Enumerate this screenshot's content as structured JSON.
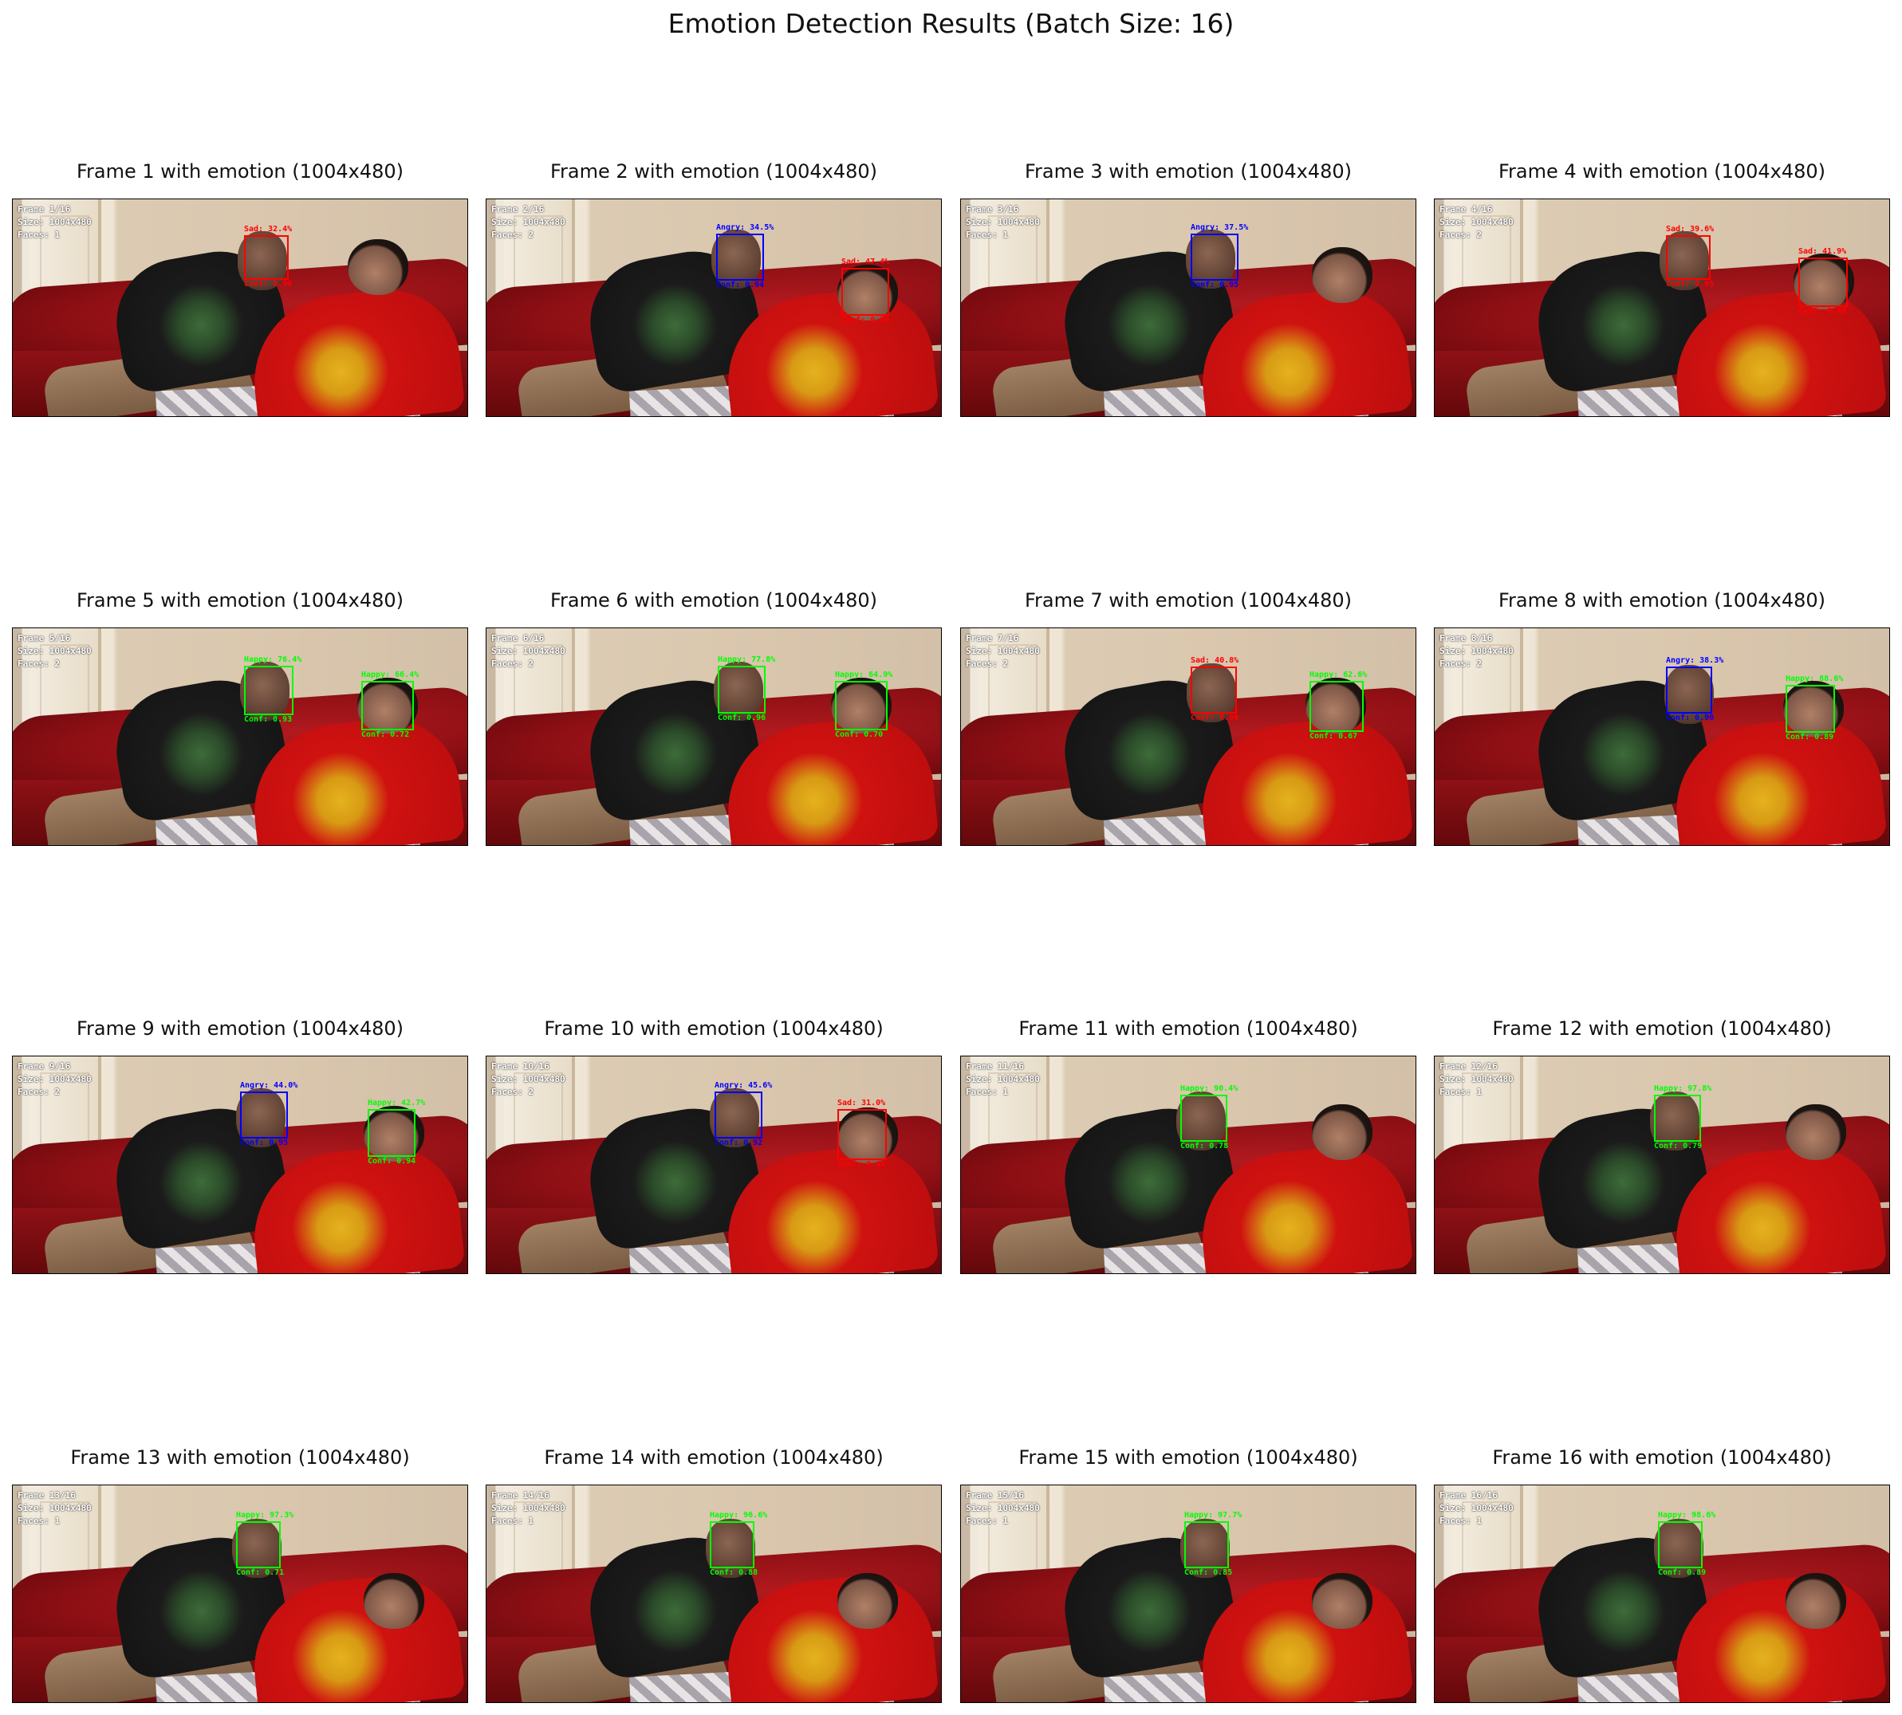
{
  "figure": {
    "title": "Emotion Detection Results (Batch Size: 16)"
  },
  "colors": {
    "happy": "#00ff00",
    "sad": "#ff0000",
    "angry": "#0000ff",
    "overlay_text": "#ffffff"
  },
  "panels": [
    {
      "title": "Frame 1 with emotion (1004x480)",
      "overlay": [
        "Frame 1/16",
        "Size: 1004x480",
        "Faces: 1"
      ],
      "faces": [
        {
          "emotion_label": "Sad: 32.4%",
          "conf_label": "Conf: 0.90",
          "emotion": "sad"
        }
      ]
    },
    {
      "title": "Frame 2 with emotion (1004x480)",
      "overlay": [
        "Frame 2/16",
        "Size: 1004x480",
        "Faces: 2"
      ],
      "faces": [
        {
          "emotion_label": "Angry: 34.5%",
          "conf_label": "Conf: 0.94",
          "emotion": "angry"
        },
        {
          "emotion_label": "Sad: 47.4%",
          "conf_label": "Conf: 0.80",
          "emotion": "sad"
        }
      ]
    },
    {
      "title": "Frame 3 with emotion (1004x480)",
      "overlay": [
        "Frame 3/16",
        "Size: 1004x480",
        "Faces: 1"
      ],
      "faces": [
        {
          "emotion_label": "Angry: 37.5%",
          "conf_label": "Conf: 0.95",
          "emotion": "angry"
        }
      ]
    },
    {
      "title": "Frame 4 with emotion (1004x480)",
      "overlay": [
        "Frame 4/16",
        "Size: 1004x480",
        "Faces: 2"
      ],
      "faces": [
        {
          "emotion_label": "Sad: 39.6%",
          "conf_label": "Conf: 0.95",
          "emotion": "sad"
        },
        {
          "emotion_label": "Sad: 41.9%",
          "conf_label": "Conf: 0.46",
          "emotion": "sad"
        }
      ]
    },
    {
      "title": "Frame 5 with emotion (1004x480)",
      "overlay": [
        "Frame 5/16",
        "Size: 1004x480",
        "Faces: 2"
      ],
      "faces": [
        {
          "emotion_label": "Happy: 76.4%",
          "conf_label": "Conf: 0.93",
          "emotion": "happy"
        },
        {
          "emotion_label": "Happy: 66.4%",
          "conf_label": "Conf: 0.72",
          "emotion": "happy"
        }
      ]
    },
    {
      "title": "Frame 6 with emotion (1004x480)",
      "overlay": [
        "Frame 6/16",
        "Size: 1004x480",
        "Faces: 2"
      ],
      "faces": [
        {
          "emotion_label": "Happy: 77.8%",
          "conf_label": "Conf: 0.96",
          "emotion": "happy"
        },
        {
          "emotion_label": "Happy: 64.9%",
          "conf_label": "Conf: 0.70",
          "emotion": "happy"
        }
      ]
    },
    {
      "title": "Frame 7 with emotion (1004x480)",
      "overlay": [
        "Frame 7/16",
        "Size: 1004x480",
        "Faces: 2"
      ],
      "faces": [
        {
          "emotion_label": "Sad: 40.8%",
          "conf_label": "Conf: 0.96",
          "emotion": "sad"
        },
        {
          "emotion_label": "Happy: 62.6%",
          "conf_label": "Conf: 0.67",
          "emotion": "happy"
        }
      ]
    },
    {
      "title": "Frame 8 with emotion (1004x480)",
      "overlay": [
        "Frame 8/16",
        "Size: 1004x480",
        "Faces: 2"
      ],
      "faces": [
        {
          "emotion_label": "Angry: 38.3%",
          "conf_label": "Conf: 0.90",
          "emotion": "angry"
        },
        {
          "emotion_label": "Happy: 88.6%",
          "conf_label": "Conf: 0.89",
          "emotion": "happy"
        }
      ]
    },
    {
      "title": "Frame 9 with emotion (1004x480)",
      "overlay": [
        "Frame 9/16",
        "Size: 1004x480",
        "Faces: 2"
      ],
      "faces": [
        {
          "emotion_label": "Angry: 44.0%",
          "conf_label": "Conf: 0.95",
          "emotion": "angry"
        },
        {
          "emotion_label": "Happy: 42.7%",
          "conf_label": "Conf: 0.94",
          "emotion": "happy"
        }
      ]
    },
    {
      "title": "Frame 10 with emotion (1004x480)",
      "overlay": [
        "Frame 10/16",
        "Size: 1004x480",
        "Faces: 2"
      ],
      "faces": [
        {
          "emotion_label": "Angry: 45.6%",
          "conf_label": "Conf: 0.92",
          "emotion": "angry"
        },
        {
          "emotion_label": "Sad: 31.0%",
          "conf_label": "Conf: 0.46",
          "emotion": "sad"
        }
      ]
    },
    {
      "title": "Frame 11 with emotion (1004x480)",
      "overlay": [
        "Frame 11/16",
        "Size: 1004x480",
        "Faces: 1"
      ],
      "faces": [
        {
          "emotion_label": "Happy: 90.4%",
          "conf_label": "Conf: 0.78",
          "emotion": "happy"
        }
      ]
    },
    {
      "title": "Frame 12 with emotion (1004x480)",
      "overlay": [
        "Frame 12/16",
        "Size: 1004x480",
        "Faces: 1"
      ],
      "faces": [
        {
          "emotion_label": "Happy: 97.8%",
          "conf_label": "Conf: 0.79",
          "emotion": "happy"
        }
      ]
    },
    {
      "title": "Frame 13 with emotion (1004x480)",
      "overlay": [
        "Frame 13/16",
        "Size: 1004x480",
        "Faces: 1"
      ],
      "faces": [
        {
          "emotion_label": "Happy: 97.3%",
          "conf_label": "Conf: 0.71",
          "emotion": "happy"
        }
      ]
    },
    {
      "title": "Frame 14 with emotion (1004x480)",
      "overlay": [
        "Frame 14/16",
        "Size: 1004x480",
        "Faces: 1"
      ],
      "faces": [
        {
          "emotion_label": "Happy: 96.6%",
          "conf_label": "Conf: 0.88",
          "emotion": "happy"
        }
      ]
    },
    {
      "title": "Frame 15 with emotion (1004x480)",
      "overlay": [
        "Frame 15/16",
        "Size: 1004x480",
        "Faces: 1"
      ],
      "faces": [
        {
          "emotion_label": "Happy: 97.7%",
          "conf_label": "Conf: 0.85",
          "emotion": "happy"
        }
      ]
    },
    {
      "title": "Frame 16 with emotion (1004x480)",
      "overlay": [
        "Frame 16/16",
        "Size: 1004x480",
        "Faces: 1"
      ],
      "faces": [
        {
          "emotion_label": "Happy: 98.6%",
          "conf_label": "Conf: 0.89",
          "emotion": "happy"
        }
      ]
    }
  ]
}
